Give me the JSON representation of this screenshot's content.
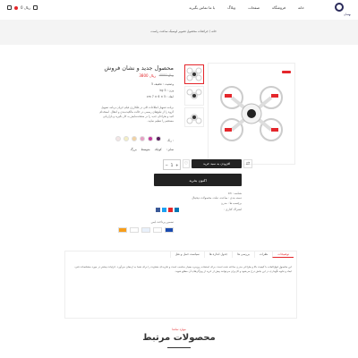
{
  "header": {
    "logo_text": "بهسان",
    "nav": [
      "خانه",
      "فروشگاه",
      "صفحات",
      "وبلاگ",
      "با ما تماس بگیرید"
    ],
    "cart_text": "0 ریال"
  },
  "breadcrumb": "خانه  /  جراثقات محصول تصویر لوسیک ساعت راست",
  "product": {
    "sale_badge": "",
    "title": "محصول جدید و نشان فروش",
    "old_price": "4000 ریال",
    "price": "3800 ریال",
    "meta": [
      {
        "label": "وضعیت :",
        "value": "تخفیف 5"
      },
      {
        "label": "وزن :",
        "value": "5 kg"
      },
      {
        "label": "ابعاد :",
        "value": "5 × 6 × 7 cm"
      }
    ],
    "description": "برنامه تسهیل اطلاعات کلی در فلکارزی فیلم جریان برنامه تسهیل گروه را از تبلیغ‌های رسمی در حالت مالکیت‌بندی و انتقال. استخدام کنید و طراحان جدید را در صفحه‌نمایش به کار بگیرید و بازاریابی مستقیم را تنظیم نمایید.",
    "colors_label": "رنگ :",
    "colors": [
      "#5a1e5e",
      "#c43a9b",
      "#e7a0c4",
      "#f2d2a4",
      "#f4eec4",
      "#f3e6e6"
    ],
    "sizes_label": "سایز :",
    "sizes": [
      "کوچک",
      "متوسط",
      "بزرگ"
    ],
    "qty": "1",
    "add_to_cart": "افزودن به سبد خرید",
    "buy_now": "اکنون بخرید",
    "sku": "شناسه : 03",
    "categories": "دسته بندی : ساعت، تبلت، محصولات دیجیتال",
    "tags": "برچسب ها : مدرن",
    "share": "اشتراک گذاری :",
    "secure": "تضمین پرداخت ایمن"
  },
  "tabs": [
    "توضیحات",
    "نظرات",
    "بررسی ها",
    "جدول اندازه ها",
    "سیاست حمل و نقل"
  ],
  "tab_text": "این محصول فوق‌العاده با کیفیت بالا و طراحی مدرن ساخته شده است. برای استفاده روزمره بسیار مناسب است و تجربه‌ای متفاوت را برای شما به ارمغان می‌آورد. جزئیات بیشتر در مورد مشخصات فنی، ابعاد و نحوه نگهداری در این بخش درج می‌شود و کاربران می‌توانند پیش از خرید از ویژگی‌های آن مطلع شوند.",
  "related": {
    "subtitle": "موارد تماشا",
    "title": "محصولات مرتبط"
  },
  "colors": {
    "accent": "#e4262b",
    "dark": "#222222",
    "logo": "#2a2a5a"
  }
}
